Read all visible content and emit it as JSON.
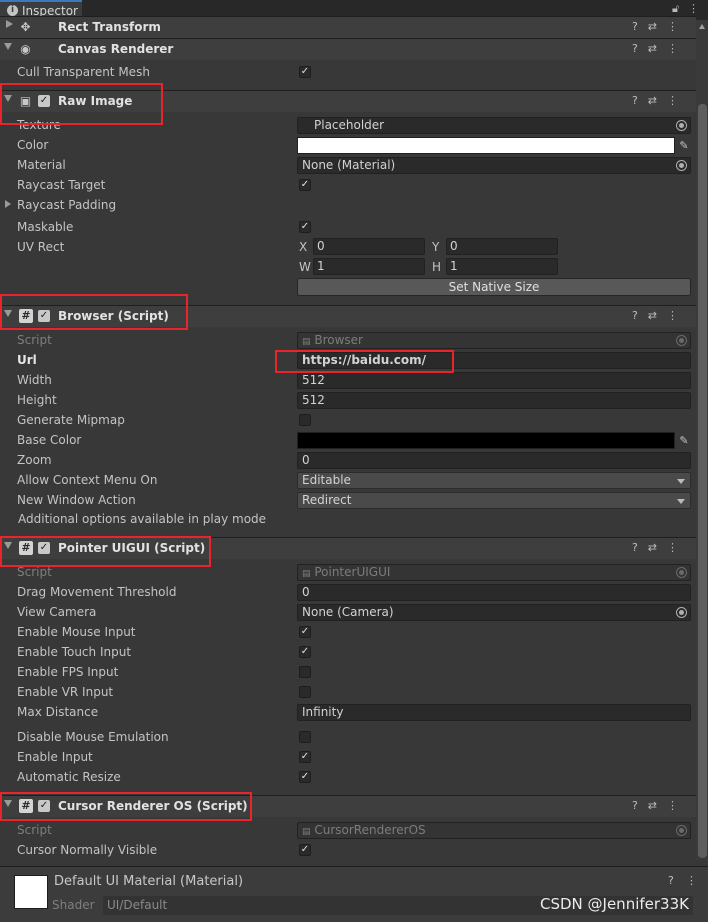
{
  "tab": {
    "title": "Inspector",
    "icon": "info-icon"
  },
  "components": {
    "rect_transform": {
      "title": "Rect Transform"
    },
    "canvas_renderer": {
      "title": "Canvas Renderer",
      "cull_label": "Cull Transparent Mesh",
      "cull_checked": true
    },
    "raw_image": {
      "title": "Raw Image",
      "texture_label": "Texture",
      "texture_value": "Placeholder",
      "color_label": "Color",
      "color_value": "#ffffff",
      "material_label": "Material",
      "material_value": "None (Material)",
      "raycast_target_label": "Raycast Target",
      "raycast_padding_label": "Raycast Padding",
      "maskable_label": "Maskable",
      "uvrect_label": "UV Rect",
      "uv": {
        "x_label": "X",
        "x": "0",
        "y_label": "Y",
        "y": "0",
        "w_label": "W",
        "w": "1",
        "h_label": "H",
        "h": "1"
      },
      "set_native_size": "Set Native Size"
    },
    "browser": {
      "title": "Browser (Script)",
      "script_label": "Script",
      "script_value": "Browser",
      "url_label": "Url",
      "url_value": "https://baidu.com/",
      "width_label": "Width",
      "width_value": "512",
      "height_label": "Height",
      "height_value": "512",
      "mipmap_label": "Generate Mipmap",
      "basecolor_label": "Base Color",
      "basecolor_value": "#000000",
      "zoom_label": "Zoom",
      "zoom_value": "0",
      "context_label": "Allow Context Menu On",
      "context_value": "Editable",
      "newwindow_label": "New Window Action",
      "newwindow_value": "Redirect",
      "note": "Additional options available in play mode"
    },
    "pointer_uigui": {
      "title": "Pointer UIGUI (Script)",
      "script_label": "Script",
      "script_value": "PointerUIGUI",
      "drag_label": "Drag Movement Threshold",
      "drag_value": "0",
      "camera_label": "View Camera",
      "camera_value": "None (Camera)",
      "mouse_label": "Enable Mouse Input",
      "touch_label": "Enable Touch Input",
      "fps_label": "Enable FPS Input",
      "vr_label": "Enable VR Input",
      "maxdist_label": "Max Distance",
      "maxdist_value": "Infinity",
      "disable_mouse_label": "Disable Mouse Emulation",
      "enable_input_label": "Enable Input",
      "auto_resize_label": "Automatic Resize"
    },
    "cursor_renderer": {
      "title": "Cursor Renderer OS (Script)",
      "script_label": "Script",
      "script_value": "CursorRendererOS",
      "visible_label": "Cursor Normally Visible"
    }
  },
  "material": {
    "title": "Default UI Material (Material)",
    "shader_label": "Shader",
    "shader_value": "UI/Default"
  },
  "watermark": "CSDN @Jennifer33K",
  "glyphs": {
    "check": "✓",
    "hash": "#",
    "eye": "◉",
    "image": "▣",
    "dropper": "✎"
  }
}
